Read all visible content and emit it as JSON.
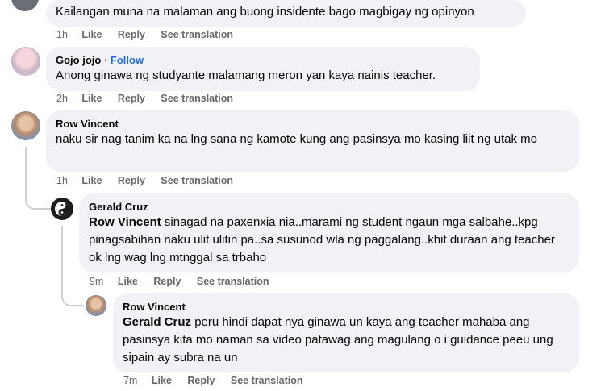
{
  "comments": [
    {
      "text": "Kailangan muna na malaman ang buong insidente bago magbigay ng opinyon",
      "time": "1h",
      "like": "Like",
      "reply": "Reply",
      "translate": "See translation"
    },
    {
      "author": "Gojo jojo",
      "separator": "·",
      "follow": "Follow",
      "text": "Anong ginawa ng studyante malamang meron yan kaya nainis teacher.",
      "time": "2h",
      "like": "Like",
      "reply": "Reply",
      "translate": "See translation"
    },
    {
      "author": "Row Vincent",
      "text": "naku sir nag tanim ka na lng sana ng kamote kung ang pasinsya mo kasing liit ng utak mo",
      "time": "1h",
      "like": "Like",
      "reply": "Reply",
      "translate": "See translation"
    },
    {
      "author": "Gerald Cruz",
      "mention": "Row Vincent",
      "text": " sinagad na paxenxia nia..marami ng student ngaun mga salbahe..kpg pinagsabihan naku ulit ulitin pa..sa susunod wla ng paggalang..khit duraan ang teacher ok lng wag lng mtnggal sa trbaho",
      "time": "9m",
      "like": "Like",
      "reply": "Reply",
      "translate": "See translation"
    },
    {
      "author": "Row Vincent",
      "mention": "Gerald Cruz",
      "text": " peru hindi dapat nya ginawa un kaya ang teacher mahaba ang pasinsya kita mo naman sa video patawag ang magulang o i guidance peeu ung sipain ay subra na un",
      "time": "7m",
      "like": "Like",
      "reply": "Reply",
      "translate": "See translation"
    }
  ]
}
